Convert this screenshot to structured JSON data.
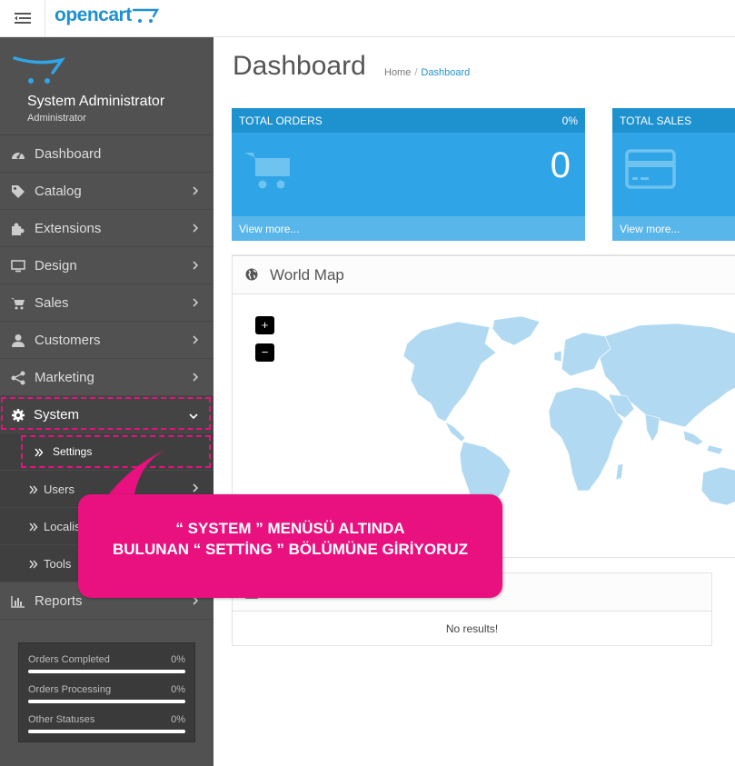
{
  "header": {
    "logo_text": "opencart",
    "brand_color": "#1e91cf"
  },
  "profile": {
    "name": "System Administrator",
    "role": "Administrator"
  },
  "sidebar": {
    "items": [
      {
        "label": "Dashboard",
        "icon": "dashboard-icon"
      },
      {
        "label": "Catalog",
        "icon": "tags-icon"
      },
      {
        "label": "Extensions",
        "icon": "puzzle-icon"
      },
      {
        "label": "Design",
        "icon": "monitor-icon"
      },
      {
        "label": "Sales",
        "icon": "cart-icon"
      },
      {
        "label": "Customers",
        "icon": "user-icon"
      },
      {
        "label": "Marketing",
        "icon": "share-icon"
      },
      {
        "label": "System",
        "icon": "gear-icon"
      }
    ],
    "system_sub": [
      {
        "label": "Settings"
      },
      {
        "label": "Users"
      },
      {
        "label": "Localis"
      },
      {
        "label": "Tools"
      }
    ],
    "reports_label": "Reports"
  },
  "stats": [
    {
      "name": "Orders Completed",
      "percent": "0%"
    },
    {
      "name": "Orders Processing",
      "percent": "0%"
    },
    {
      "name": "Other Statuses",
      "percent": "0%"
    }
  ],
  "page": {
    "title": "Dashboard",
    "breadcrumb": [
      "Home",
      "Dashboard"
    ]
  },
  "tiles": [
    {
      "title": "TOTAL ORDERS",
      "percent": "0%",
      "value": "0",
      "link": "View more...",
      "icon": "cart-icon"
    },
    {
      "title": "TOTAL SALES",
      "percent": "",
      "value": "",
      "link": "View more...",
      "icon": "credit-card-icon"
    }
  ],
  "world_map": {
    "title": "World Map",
    "zoom_in": "+",
    "zoom_out": "−"
  },
  "activity": {
    "no_results": "No results!"
  },
  "callout": {
    "line1": "“ SYSTEM ” MENÜSÜ ALTINDA",
    "line2": "BULUNAN “ SETTİNG ” BÖLÜMÜNE GİRİYORUZ",
    "color": "#e8117f"
  }
}
